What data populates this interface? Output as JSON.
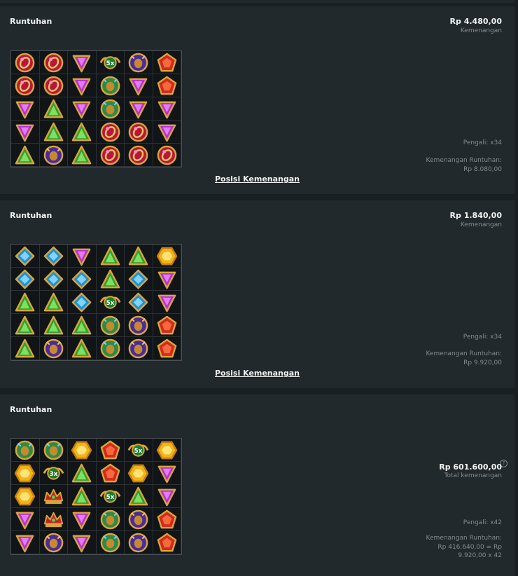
{
  "symbols": {
    "R": "red-ring-icon",
    "P": "purple-triangle-icon",
    "G": "green-triangle-icon",
    "W": "wild-multiplier-icon",
    "S": "purple-scarab-icon",
    "O": "red-pentagon-icon",
    "C": "green-scarab-icon",
    "B": "blue-diamond-icon",
    "Y": "yellow-hexagon-icon",
    "K": "red-crown-icon"
  },
  "colors": {
    "panel": "#22292c",
    "background": "#1a1f22",
    "muted_text": "#838a8f",
    "text": "#f2f2f2"
  },
  "panels": [
    {
      "title": "Runtuhan",
      "amount": "Rp 4.480,00",
      "amount_label": "Kemenangan",
      "multiplier": "Pengali: x34",
      "cascade_label": "Kemenangan Runtuhan:",
      "cascade_value": "Rp 8.080,00",
      "link": "Posisi Kemenangan",
      "grid": [
        [
          "R",
          "R",
          "P",
          {
            "w": "5x"
          },
          "S",
          "O"
        ],
        [
          "R",
          "R",
          "P",
          "C",
          "P",
          "O"
        ],
        [
          "P",
          "G",
          "P",
          "C",
          "P",
          "P"
        ],
        [
          "P",
          "G",
          "G",
          "R",
          "R",
          "P"
        ],
        [
          "G",
          "S",
          "G",
          "R",
          "R",
          "R"
        ]
      ]
    },
    {
      "title": "Runtuhan",
      "amount": "Rp 1.840,00",
      "amount_label": "Kemenangan",
      "multiplier": "Pengali: x34",
      "cascade_label": "Kemenangan Runtuhan:",
      "cascade_value": "Rp 9.920,00",
      "link": "Posisi Kemenangan",
      "grid": [
        [
          "B",
          "B",
          "P",
          "G",
          "G",
          "Y"
        ],
        [
          "B",
          "B",
          "B",
          "G",
          "B",
          "P"
        ],
        [
          "G",
          "G",
          "B",
          {
            "w": "5x"
          },
          "B",
          "P"
        ],
        [
          "G",
          "G",
          "G",
          "C",
          "S",
          "O"
        ],
        [
          "G",
          "S",
          "G",
          "C",
          "S",
          "O"
        ]
      ]
    },
    {
      "title": "Runtuhan",
      "amount": "Rp 601.600,00",
      "amount_label": "Total kemenangan",
      "info": "?",
      "multiplier": "Pengali: x42",
      "cascade_label": "Kemenangan Runtuhan:",
      "cascade_value": "Rp 416.640,00 = Rp",
      "cascade_value2": "9.920,00 x 42",
      "grid": [
        [
          "C",
          "C",
          "Y",
          "O",
          {
            "w": "5x"
          },
          "Y"
        ],
        [
          "Y",
          {
            "w": "3x"
          },
          "G",
          "O",
          "Y",
          "P"
        ],
        [
          "Y",
          "K",
          "G",
          {
            "w": "5x"
          },
          "G",
          "P"
        ],
        [
          "P",
          "K",
          "P",
          "C",
          "S",
          "O"
        ],
        [
          "P",
          "S",
          "P",
          "C",
          "S",
          "O"
        ]
      ]
    }
  ]
}
